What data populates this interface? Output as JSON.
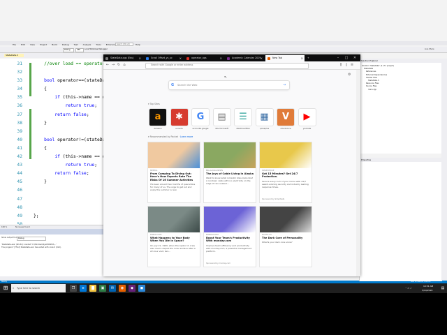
{
  "vs": {
    "menu": [
      "File",
      "Edit",
      "View",
      "Project",
      "Build",
      "Debug",
      "Test",
      "Analyze",
      "Tools",
      "Extensions",
      "Window",
      "Help"
    ],
    "toolbar": {
      "config": "Debug",
      "platform": "x86",
      "debugger": "Local Windows Debugger",
      "search": "Search (Ctrl+Q)",
      "live_share": "Live Share"
    },
    "tab": "StateData.h",
    "line_numbers": [
      "31",
      "32",
      "33",
      "34",
      "35",
      "36",
      "37",
      "38",
      "39",
      "40",
      "41",
      "42",
      "43",
      "44",
      "45",
      "46",
      "47",
      "48",
      "49",
      "50",
      "51"
    ],
    "code_lines": [
      {
        "indent": "    ",
        "parts": [
          {
            "t": "//over load == operator",
            "c": "cm"
          }
        ]
      },
      {
        "indent": "",
        "parts": []
      },
      {
        "indent": "    ",
        "parts": [
          {
            "t": "bool",
            "c": "kw"
          },
          {
            "t": " operator==(stateData"
          }
        ]
      },
      {
        "indent": "    ",
        "parts": [
          {
            "t": "{"
          }
        ]
      },
      {
        "indent": "        ",
        "parts": [
          {
            "t": "if",
            "c": "kw"
          },
          {
            "t": " (this->name == oth"
          }
        ]
      },
      {
        "indent": "            ",
        "parts": [
          {
            "t": "return",
            "c": "kw"
          },
          {
            "t": " "
          },
          {
            "t": "true",
            "c": "kw"
          },
          {
            "t": ";"
          }
        ]
      },
      {
        "indent": "        ",
        "parts": [
          {
            "t": "return",
            "c": "kw"
          },
          {
            "t": " "
          },
          {
            "t": "false",
            "c": "kw"
          },
          {
            "t": ";"
          }
        ]
      },
      {
        "indent": "    ",
        "parts": [
          {
            "t": "}"
          }
        ]
      },
      {
        "indent": "",
        "parts": []
      },
      {
        "indent": "    ",
        "parts": [
          {
            "t": "bool",
            "c": "kw"
          },
          {
            "t": " operator!=(stateData"
          }
        ]
      },
      {
        "indent": "    ",
        "parts": [
          {
            "t": "{"
          }
        ]
      },
      {
        "indent": "        ",
        "parts": [
          {
            "t": "if",
            "c": "kw"
          },
          {
            "t": " (this->name == oth"
          }
        ]
      },
      {
        "indent": "            ",
        "parts": [
          {
            "t": "return",
            "c": "kw"
          },
          {
            "t": " "
          },
          {
            "t": "true",
            "c": "kw"
          },
          {
            "t": ";"
          }
        ]
      },
      {
        "indent": "        ",
        "parts": [
          {
            "t": "return",
            "c": "kw"
          },
          {
            "t": " "
          },
          {
            "t": "false",
            "c": "kw"
          },
          {
            "t": ";"
          }
        ]
      },
      {
        "indent": "    ",
        "parts": [
          {
            "t": "}"
          }
        ]
      },
      {
        "indent": "",
        "parts": []
      },
      {
        "indent": "",
        "parts": []
      },
      {
        "indent": "",
        "parts": []
      },
      {
        "indent": "",
        "parts": [
          {
            "t": "};"
          }
        ]
      },
      {
        "indent": "",
        "parts": []
      },
      {
        "indent": "",
        "parts": []
      }
    ],
    "status_zoom": "100 %",
    "status_issues": "No issues found",
    "output": {
      "title": "Output",
      "show_from": "Show output from:",
      "show_from_value": "Debug",
      "lines": [
        "'StateData.exe' (Win32): Loaded 'C:\\Windows\\SysWOW64\\...'",
        "The program '[7512] StateData.exe' has exited with code 0 (0x0)."
      ],
      "tabs": [
        "Error List",
        "Output"
      ]
    },
    "status_bar": {
      "left": "Ready",
      "right": "Add to Source Control"
    },
    "solution_explorer": {
      "title": "Solution Explorer",
      "items": [
        "Solution 'StateData' (1 of 1 project)",
        "StateData",
        "References",
        "External Dependencies",
        "Header Files",
        "StateData.h",
        "Resource Files",
        "Source Files",
        "main.cpp"
      ]
    },
    "properties": {
      "title": "Properties"
    }
  },
  "firefox": {
    "tabs": [
      {
        "label": "StateData.cpp (Edu)",
        "color": "#7a7a7a"
      },
      {
        "label": "Scroll Offset_ys_uc",
        "color": "#2b7de9"
      },
      {
        "label": "operator_ops",
        "color": "#d93025"
      },
      {
        "label": "Academic Calendar 2019",
        "color": "#7a2e8e"
      },
      {
        "label": "New Tab",
        "color": "#e66000",
        "active": true
      }
    ],
    "url_placeholder": "Search with Google or enter address",
    "search_placeholder": "Search the Web",
    "top_sites_header": "Top Sites",
    "top_sites": [
      {
        "label": "Amazon",
        "color": "#111111",
        "glyph": "a",
        "fg": "#ff9900"
      },
      {
        "label": "uni.edu",
        "color": "#d63b2f",
        "glyph": "✱",
        "fg": "#ffffff"
      },
      {
        "label": "accounts.google",
        "color": "#ffffff",
        "glyph": "G",
        "fg": "#4285f4"
      },
      {
        "label": "dev.microsoft",
        "color": "#ffffff",
        "glyph": "▤",
        "fg": "#777777"
      },
      {
        "label": "stackoverflow",
        "color": "#ffffff",
        "glyph": "☰",
        "fg": "#2aa198"
      },
      {
        "label": "cplusplus",
        "color": "#ffffff",
        "glyph": "▦",
        "fg": "#3a6ea5"
      },
      {
        "label": "cloudvorce",
        "color": "#e07b39",
        "glyph": "V",
        "fg": "#ffffff"
      },
      {
        "label": "youtube",
        "color": "#ffffff",
        "glyph": "▶",
        "fg": "#ff0000"
      }
    ],
    "pocket_header": "Recommended by Pocket",
    "pocket_learn": "Learn more",
    "cards": [
      {
        "source": "MENTAL",
        "title": "From Camping To Diving Out: Here's How Experts Rate The Risks Of 16 Summer Activities",
        "desc": "It's been around two months of quarantine for many of us. The urge to get out and enjoy the summer is real.",
        "sponsored": "",
        "color": "#f0c9a0",
        "accent": "#4a90d9"
      },
      {
        "source": "BIG.ALASKA.NEWS",
        "title": "The Joys of Cable Living in Alaska",
        "desc": "Want to know what romantic bliss looks like? A rundown cable with no electricity on the edge of rain-soaked...",
        "sponsored": "",
        "color": "#8aa861",
        "accent": "#c7a35b"
      },
      {
        "source": "SMART.EQUIP",
        "title": "Got 15 Minutes? Get 24/7 Protection.",
        "desc": "Secure every inch of your home with 24/7 award-winning security and industry leading response times.",
        "sponsored": "Sponsored by SimpliSafe",
        "color": "#e8c84b",
        "accent": "#ffffff"
      },
      {
        "source": "POPSCI.COM",
        "title": "What Happens to Your Body When You Die in Space?",
        "desc": "On July 21, 1969, when the Apollo 11 crew was due to depart the lunar surface after a 22-hour visit, two...",
        "sponsored": "",
        "color": "#7b8a86",
        "accent": "#3c4a48"
      },
      {
        "source": "MONDAY.COM",
        "title": "Boost Your Team's Productivity With monday.com",
        "desc": "Improve team efficiency and productivity with monday.com, a powerful management platform.",
        "sponsored": "Sponsored by monday.com",
        "color": "#6c63d6",
        "accent": "#ffffff"
      },
      {
        "source": "NAUTIL.US",
        "title": "The Dark Core of Personality",
        "desc": "What's your dark core score?",
        "sponsored": "",
        "color": "#444444",
        "accent": "#dddddd"
      }
    ]
  },
  "taskbar": {
    "search_placeholder": "Type here to search",
    "apps": [
      {
        "name": "task-view",
        "color": "#444444",
        "glyph": "❐"
      },
      {
        "name": "edge",
        "color": "#0078d7",
        "glyph": "e"
      },
      {
        "name": "file-explorer",
        "color": "#f4c542",
        "glyph": "▇"
      },
      {
        "name": "store",
        "color": "#2d7d46",
        "glyph": "▣"
      },
      {
        "name": "mail",
        "color": "#0063b1",
        "glyph": "✉"
      },
      {
        "name": "firefox",
        "color": "#e66000",
        "glyph": "◉"
      },
      {
        "name": "visual-studio",
        "color": "#68217a",
        "glyph": "◆"
      },
      {
        "name": "app",
        "color": "#2b88d8",
        "glyph": "◼"
      }
    ],
    "time": "10:51 AM",
    "date": "5/19/2020"
  }
}
